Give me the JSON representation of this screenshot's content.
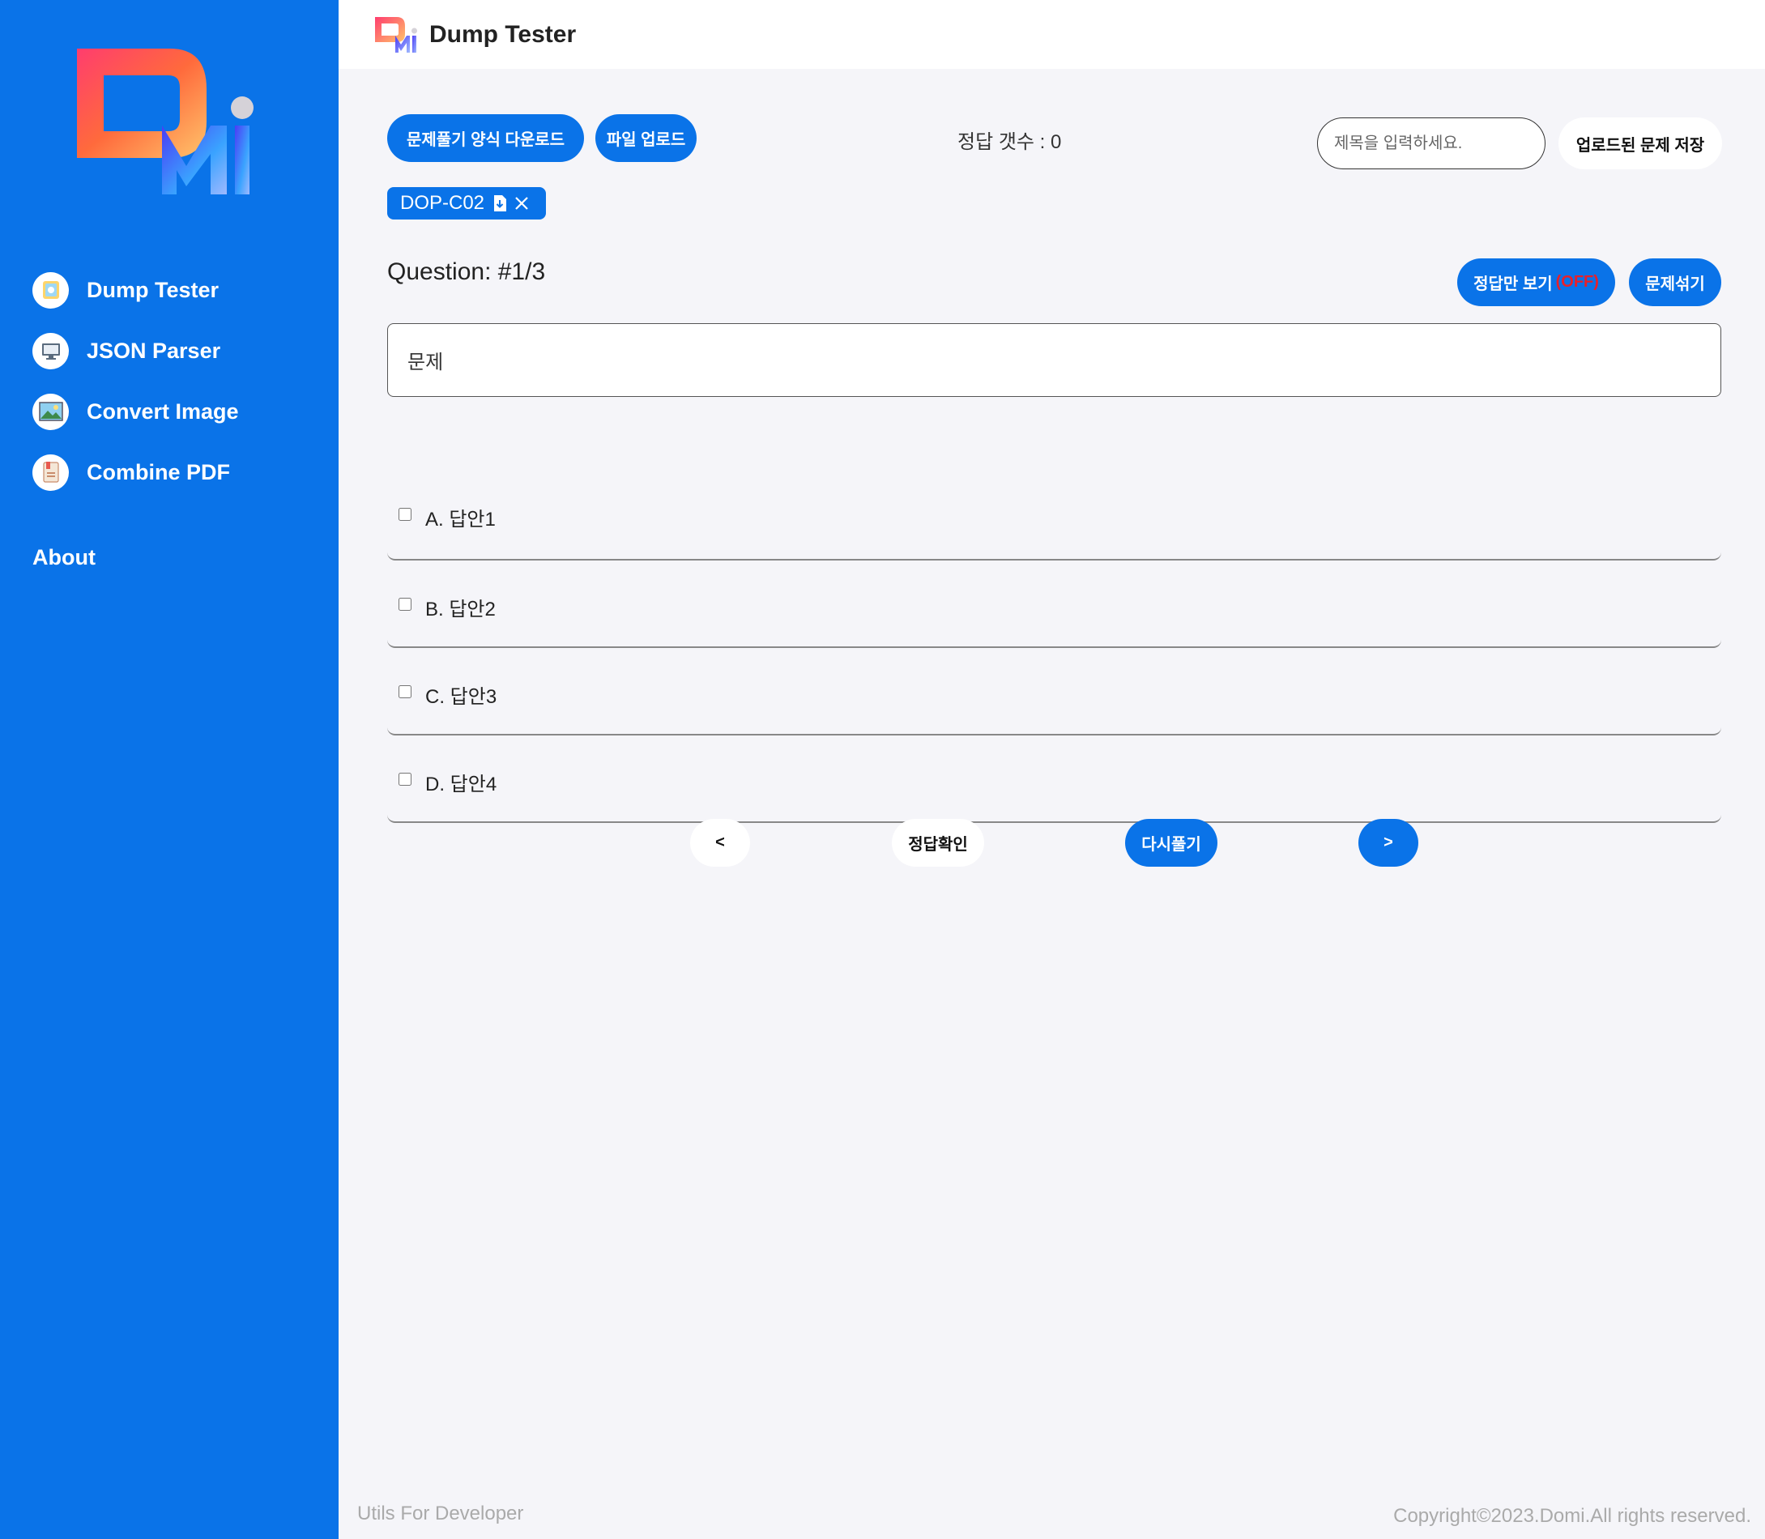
{
  "sidebar": {
    "items": [
      {
        "label": "Dump Tester",
        "icon": "exam-icon"
      },
      {
        "label": "JSON Parser",
        "icon": "monitor-icon"
      },
      {
        "label": "Convert Image",
        "icon": "image-icon"
      },
      {
        "label": "Combine PDF",
        "icon": "pdf-icon"
      }
    ],
    "about": "About"
  },
  "header": {
    "title": "Dump Tester"
  },
  "toolbar": {
    "download_template": "문제풀기 양식 다운로드",
    "upload_file": "파일 업로드",
    "correct_count": "정답 갯수 : 0",
    "title_placeholder": "제목을 입력하세요.",
    "save_uploaded": "업로드된 문제 저장"
  },
  "file_tag": {
    "name": "DOP-C02"
  },
  "question": {
    "number": "Question: #1/3",
    "show_answers_label": "정답만 보기",
    "show_answers_state": "(OFF)",
    "shuffle_label": "문제섞기",
    "text": "문제",
    "answers": [
      "A. 답안1",
      "B. 답안2",
      "C. 답안3",
      "D. 답안4"
    ]
  },
  "nav_buttons": {
    "prev": "<",
    "check": "정답확인",
    "retry": "다시풀기",
    "next": ">"
  },
  "footer": {
    "left": "Utils For Developer",
    "right": "Copyright©2023.Domi.All rights reserved."
  },
  "colors": {
    "primary": "#0a73e8",
    "off": "#e8202a",
    "background": "#f5f5f9"
  }
}
